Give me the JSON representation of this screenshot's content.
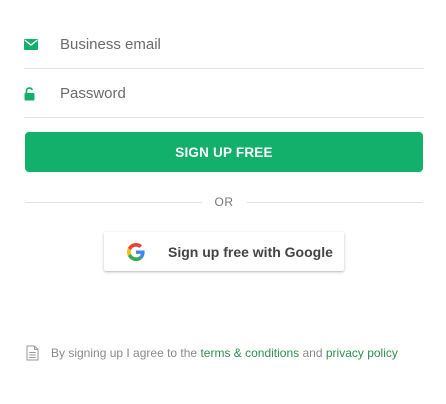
{
  "form": {
    "email": {
      "placeholder": "Business email",
      "value": "",
      "icon": "envelope-icon"
    },
    "password": {
      "placeholder": "Password",
      "value": "",
      "icon": "unlock-icon"
    },
    "signup_button": "SIGN UP FREE",
    "divider_text": "OR",
    "google_button": {
      "label": "Sign up free with Google",
      "icon": "google-g-icon"
    }
  },
  "terms": {
    "icon": "document-icon",
    "prefix": "By signing up I agree to the ",
    "terms_link": "terms & conditions",
    "middle": " and ",
    "privacy_link": "privacy policy"
  },
  "colors": {
    "accent": "#12b06a",
    "link": "#2f8f4e",
    "divider": "#e3e3e3"
  }
}
